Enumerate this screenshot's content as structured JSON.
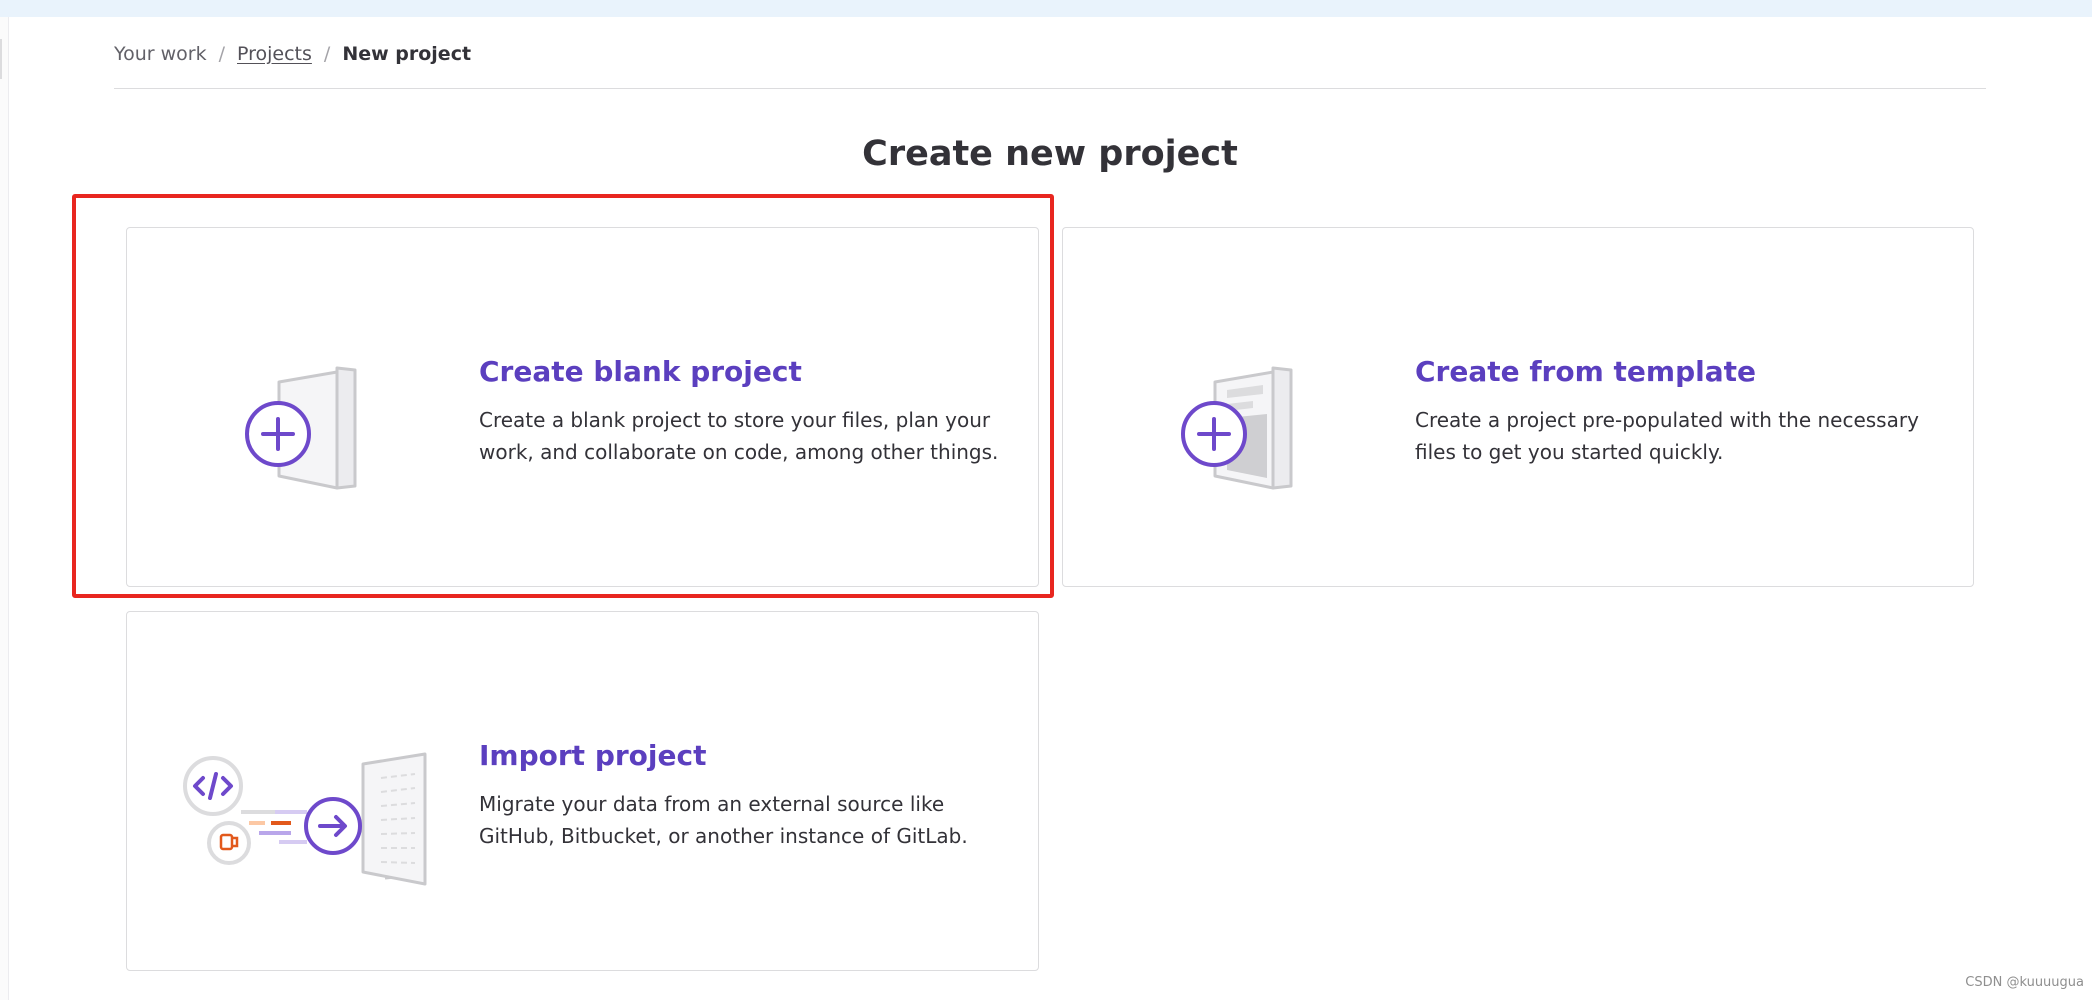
{
  "breadcrumb": {
    "your_work": "Your work",
    "projects": "Projects",
    "current": "New project",
    "separator": "/"
  },
  "page": {
    "title": "Create new project"
  },
  "cards": {
    "blank": {
      "title": "Create blank project",
      "description": "Create a blank project to store your files, plan your work, and collaborate on code, among other things.",
      "icon": "blank-project-illustration"
    },
    "template": {
      "title": "Create from template",
      "description": "Create a project pre-populated with the necessary files to get you started quickly.",
      "icon": "template-project-illustration"
    },
    "import": {
      "title": "Import project",
      "description": "Migrate your data from an external source like GitHub, Bitbucket, or another instance of GitLab.",
      "icon": "import-project-illustration"
    }
  },
  "watermark": "CSDN @kuuuugua",
  "colors": {
    "accent": "#5b3fbf",
    "highlight": "#e8261f",
    "top_strip": "#e9f3fc"
  }
}
